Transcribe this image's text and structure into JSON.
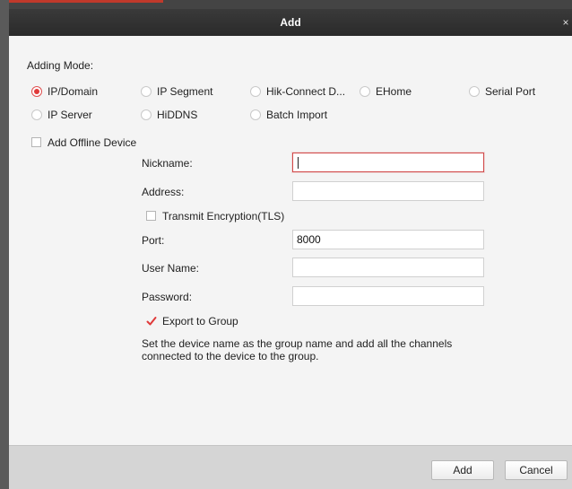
{
  "window": {
    "title": "Add",
    "close_glyph": "×"
  },
  "adding_mode": {
    "label": "Adding Mode:",
    "options": [
      "IP/Domain",
      "IP Segment",
      "Hik-Connect D...",
      "EHome",
      "Serial Port",
      "IP Server",
      "HiDDNS",
      "Batch Import"
    ],
    "selected": "IP/Domain"
  },
  "offline": {
    "label": "Add Offline Device",
    "checked": false
  },
  "form": {
    "nickname": {
      "label": "Nickname:",
      "value": ""
    },
    "address": {
      "label": "Address:",
      "value": ""
    },
    "tls": {
      "label": "Transmit Encryption(TLS)",
      "checked": false
    },
    "port": {
      "label": "Port:",
      "value": "8000"
    },
    "username": {
      "label": "User Name:",
      "value": ""
    },
    "password": {
      "label": "Password:",
      "value": ""
    }
  },
  "export_group": {
    "label": "Export to Group",
    "checked": true,
    "description": "Set the device name as the group name and add all the channels connected to the device to the group."
  },
  "buttons": {
    "add": "Add",
    "cancel": "Cancel"
  },
  "colors": {
    "accent": "#e03a3a",
    "titlebar": "#2f2f2f",
    "footer": "#d5d5d5"
  },
  "icons": {
    "close": "close-icon",
    "check": "checkmark-icon"
  }
}
